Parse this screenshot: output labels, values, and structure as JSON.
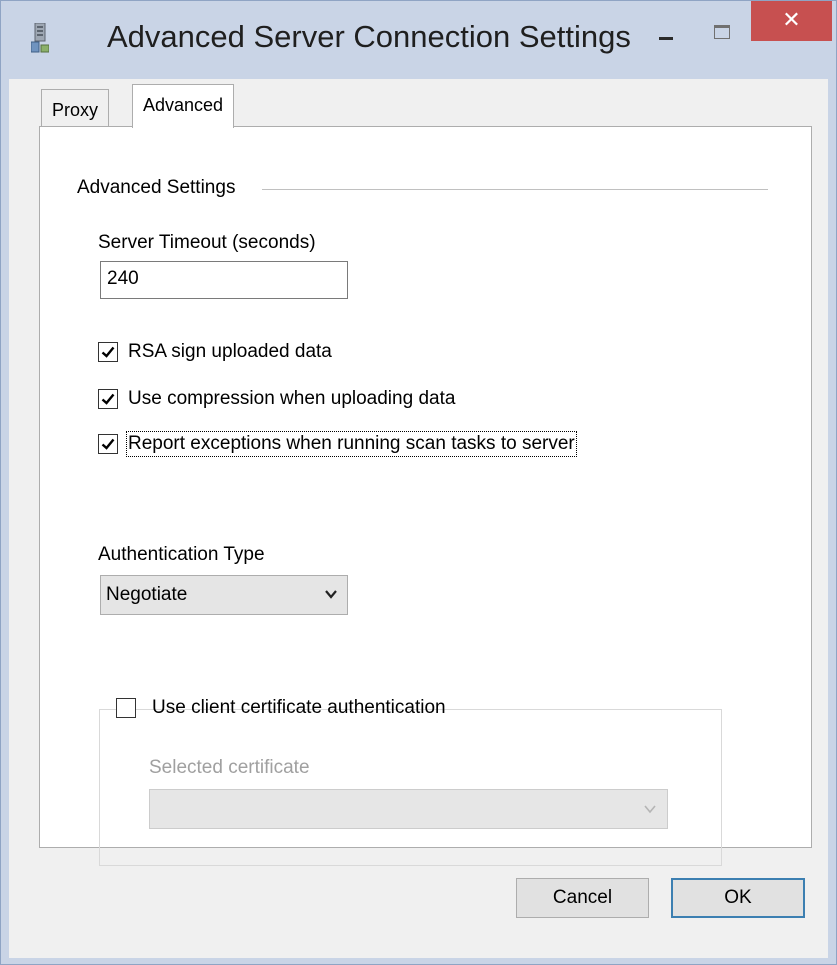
{
  "window": {
    "title": "Advanced Server Connection Settings",
    "close_glyph": "✕"
  },
  "tabs": [
    {
      "label": "Proxy",
      "selected": false
    },
    {
      "label": "Advanced",
      "selected": true
    }
  ],
  "advanced": {
    "group_title": "Advanced Settings",
    "timeout_label": "Server Timeout (seconds)",
    "timeout_value": "240",
    "checkboxes": [
      {
        "label": "RSA sign uploaded data",
        "checked": true
      },
      {
        "label": "Use compression when uploading data",
        "checked": true
      },
      {
        "label": "Report exceptions when running scan tasks to server",
        "checked": true
      }
    ],
    "auth_label": "Authentication Type",
    "auth_value": "Negotiate",
    "client_cert": {
      "label": "Use client certificate authentication",
      "checked": false,
      "selected_label": "Selected certificate",
      "selected_value": ""
    }
  },
  "buttons": {
    "cancel": "Cancel",
    "ok": "OK"
  },
  "colors": {
    "close_button": "#c75050",
    "frame": "#c9d4e6",
    "default_button_border": "#3c7fb1"
  }
}
